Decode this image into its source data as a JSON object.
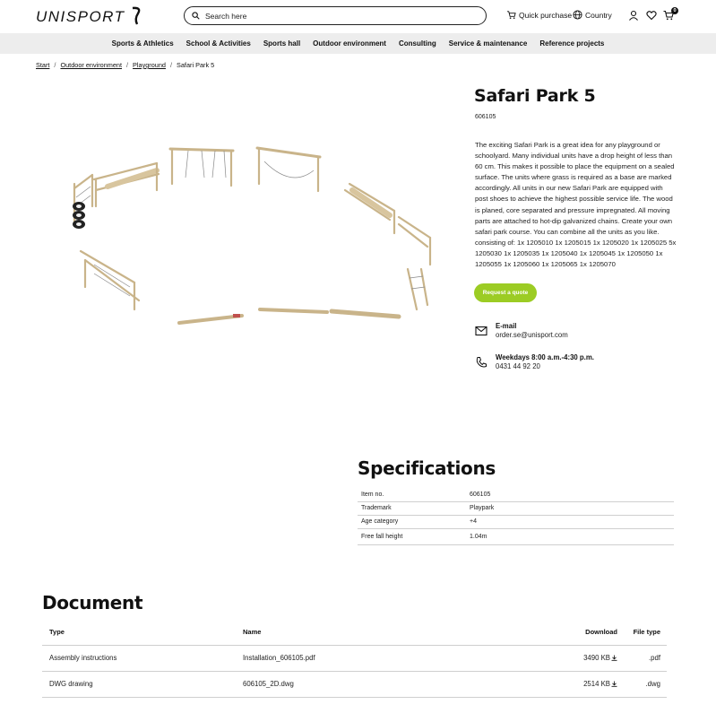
{
  "header": {
    "brand": "UNISPORT",
    "search_placeholder": "Search here",
    "quick_purchase": "Quick purchase",
    "country": "Country",
    "cart_count": "0"
  },
  "nav": [
    "Sports & Athletics",
    "School & Activities",
    "Sports hall",
    "Outdoor environment",
    "Consulting",
    "Service & maintenance",
    "Reference projects"
  ],
  "breadcrumb": [
    "Start",
    "Outdoor environment",
    "Playground",
    "Safari Park 5"
  ],
  "product": {
    "title": "Safari Park 5",
    "sku": "606105",
    "description": "The exciting Safari Park is a great idea for any playground or schoolyard. Many individual units have a drop height of less than 60 cm. This makes it possible to place the equipment on a sealed surface. The units where grass is required as a base are marked accordingly. All units in our new Safari Park are equipped with post shoes to achieve the highest possible service life. The wood is planed, core separated and pressure impregnated. All moving parts are attached to hot-dip galvanized chains. Create your own safari park course. You can combine all the units as you like. consisting of: 1x 1205010 1x 1205015 1x 1205020 1x 1205025 5x 1205030 1x 1205035 1x 1205040 1x 1205045 1x 1205050 1x 1205055 1x 1205060 1x 1205065 1x 1205070",
    "quote_button": "Request a quote",
    "accent_color": "#9ccc24"
  },
  "contact": {
    "email_label": "E-mail",
    "email": "order.se@unisport.com",
    "hours_label": "Weekdays 8:00 a.m.-4:30 p.m.",
    "phone": "0431 44 92 20"
  },
  "specifications": {
    "title": "Specifications",
    "rows": [
      {
        "label": "Item no.",
        "value": "606105"
      },
      {
        "label": "Trademark",
        "value": "Playpark"
      },
      {
        "label": "Age category",
        "value": "+4"
      },
      {
        "label": "Free fall height",
        "value": "1.04m"
      }
    ]
  },
  "document": {
    "title": "Document",
    "headers": {
      "type": "Type",
      "name": "Name",
      "download": "Download",
      "file_type": "File type"
    },
    "rows": [
      {
        "type": "Assembly instructions",
        "name": "Installation_606105.pdf",
        "size": "3490 KB",
        "ext": ".pdf"
      },
      {
        "type": "DWG drawing",
        "name": "606105_2D.dwg",
        "size": "2514 KB",
        "ext": ".dwg"
      }
    ]
  }
}
